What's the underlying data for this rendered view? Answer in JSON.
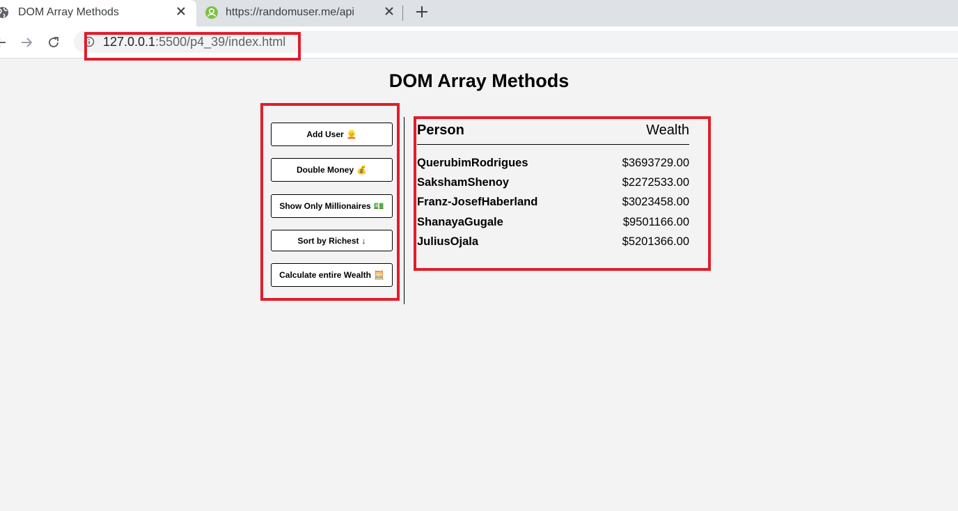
{
  "browser": {
    "tabs": [
      {
        "title": "DOM Array Methods",
        "active": true
      },
      {
        "title": "https://randomuser.me/api",
        "active": false
      }
    ],
    "url": {
      "host": "127.0.0.1",
      "rest": ":5500/p4_39/index.html"
    }
  },
  "page": {
    "title": "DOM Array Methods",
    "buttons": [
      {
        "label": "Add User",
        "icon": "👱"
      },
      {
        "label": "Double Money",
        "icon": "💰"
      },
      {
        "label": "Show Only Millionaires",
        "icon": "💵"
      },
      {
        "label": "Sort by Richest",
        "icon": "↓"
      },
      {
        "label": "Calculate entire Wealth",
        "icon": "🧮"
      }
    ],
    "table": {
      "header_person": "Person",
      "header_wealth": "Wealth",
      "rows": [
        {
          "name": "QuerubimRodrigues",
          "wealth": "$3693729.00"
        },
        {
          "name": "SakshamShenoy",
          "wealth": "$2272533.00"
        },
        {
          "name": "Franz-JosefHaberland",
          "wealth": "$3023458.00"
        },
        {
          "name": "ShanayaGugale",
          "wealth": "$9501166.00"
        },
        {
          "name": "JuliusOjala",
          "wealth": "$5201366.00"
        }
      ]
    }
  },
  "colors": {
    "annotation": "#e11d2a",
    "background": "#f3f3f3"
  }
}
